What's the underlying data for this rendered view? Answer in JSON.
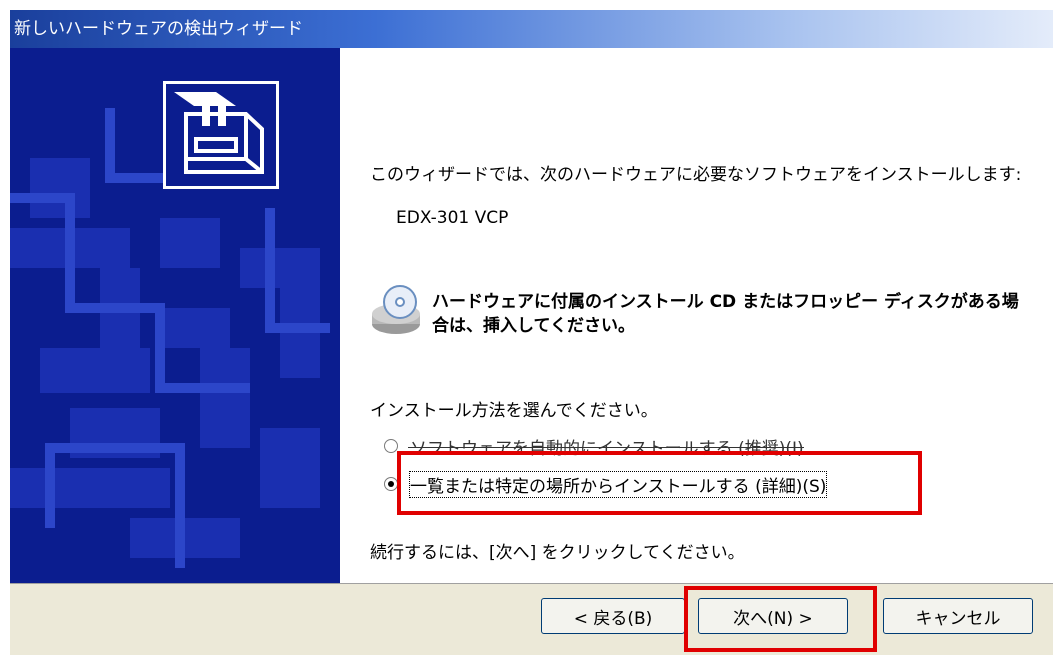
{
  "window": {
    "title": "新しいハードウェアの検出ウィザード"
  },
  "content": {
    "intro": "このウィザードでは、次のハードウェアに必要なソフトウェアをインストールします:",
    "device": "EDX-301 VCP",
    "cd_instruction": "ハードウェアに付属のインストール CD またはフロッピー ディスクがある場合は、挿入してください。",
    "choose_method": "インストール方法を選んでください。",
    "options": [
      {
        "label": "ソフトウェアを自動的にインストールする (推奨)(I)",
        "selected": false
      },
      {
        "label": "一覧または特定の場所からインストールする (詳細)(S)",
        "selected": true
      }
    ],
    "continue_text": "続行するには、[次へ] をクリックしてください。"
  },
  "buttons": {
    "back": "< 戻る(B)",
    "next": "次へ(N) >",
    "cancel": "キャンセル"
  },
  "icons": {
    "hardware": "hardware-card-icon",
    "cd": "cd-drive-icon"
  },
  "colors": {
    "title_bar": "#3c6fd4",
    "side_panel": "#0b1d8f",
    "highlight": "#e00000",
    "footer": "#ece9d8"
  }
}
